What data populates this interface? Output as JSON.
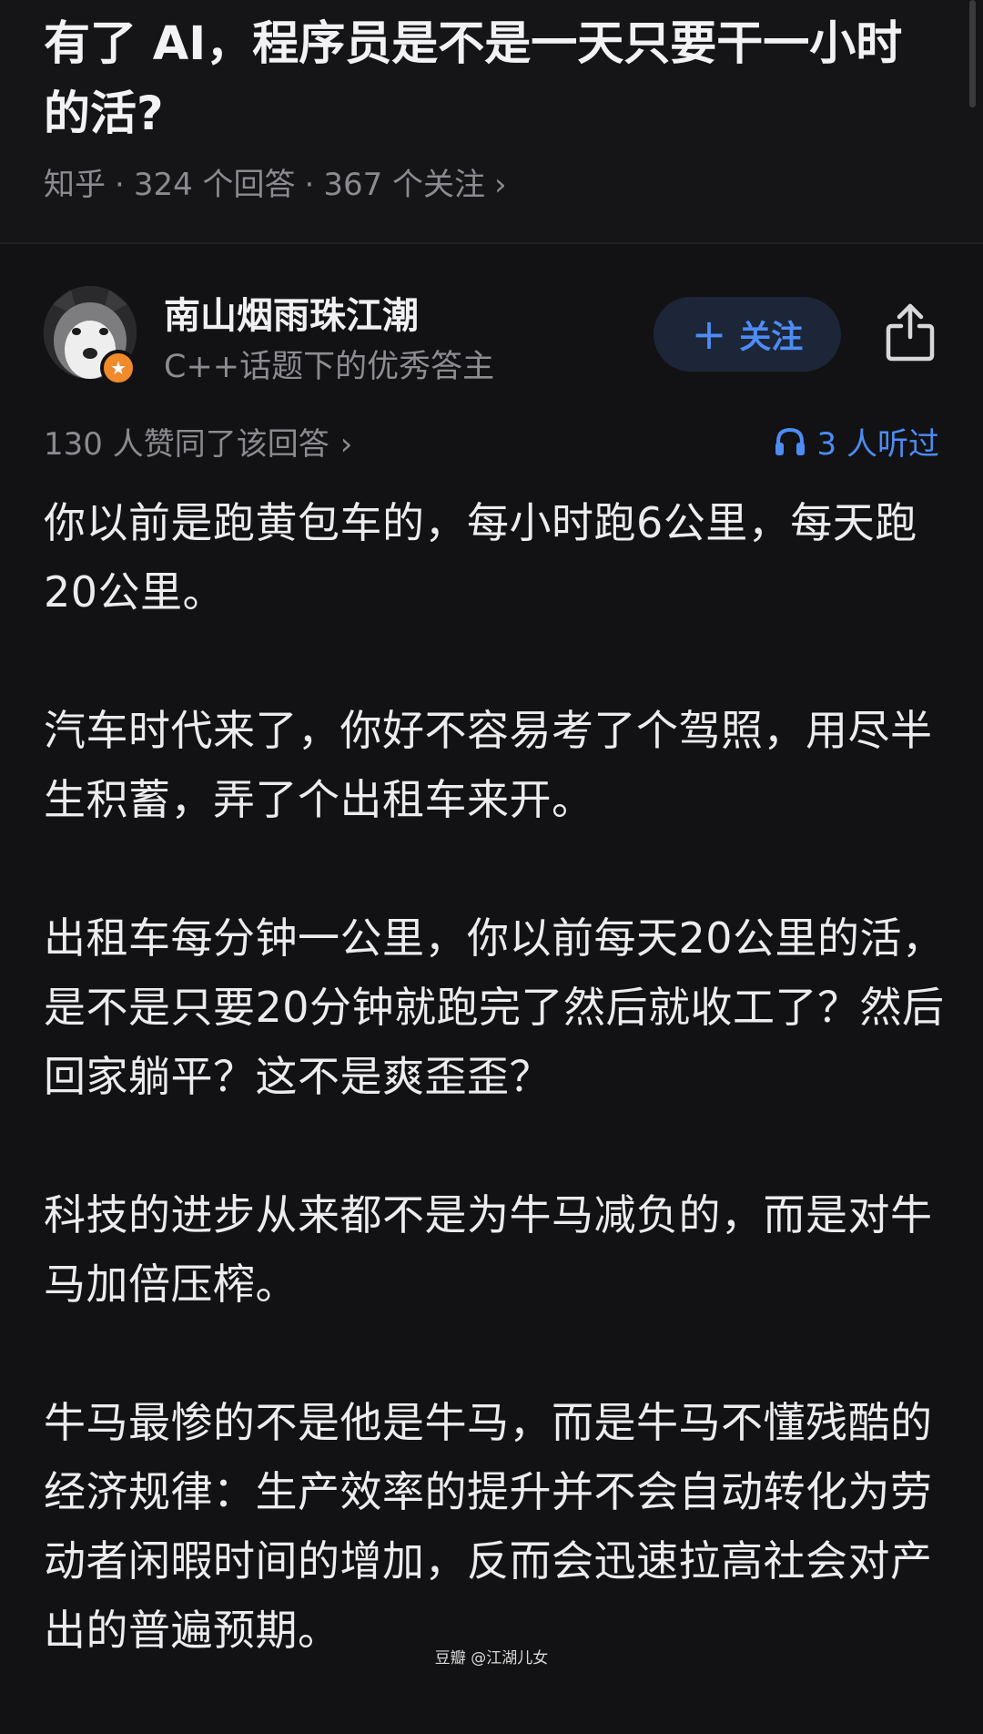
{
  "question": {
    "title": "有了 AI，程序员是不是一天只要干一小时的活?",
    "source": "知乎",
    "answers_count": "324 个回答",
    "followers_count": "367 个关注",
    "separator": "·",
    "chevron": "›"
  },
  "author": {
    "name": "南山烟雨珠江潮",
    "description": "C++话题下的优秀答主",
    "follow_label": "关注",
    "follow_plus": "+"
  },
  "stats": {
    "likes_text": "130 人赞同了该回答",
    "likes_chevron": "›",
    "listened_text": "3 人听过"
  },
  "answer": {
    "paragraphs": [
      "你以前是跑黄包车的，每小时跑6公里，每天跑20公里。",
      "汽车时代来了，你好不容易考了个驾照，用尽半生积蓄，弄了个出租车来开。",
      "出租车每分钟一公里，你以前每天20公里的活，是不是只要20分钟就跑完了然后就收工了？然后回家躺平？这不是爽歪歪？",
      "科技的进步从来都不是为牛马减负的，而是对牛马加倍压榨。",
      "牛马最惨的不是他是牛马，而是牛马不懂残酷的经济规律：生产效率的提升并不会自动转化为劳动者闲暇时间的增加，反而会迅速拉高社会对产出的普遍预期。"
    ]
  },
  "watermark": "豆瓣 @江湖儿女",
  "colors": {
    "background": "#121214",
    "accent": "#4d8cf5",
    "badge": "#f08a2a",
    "muted_text": "#8a8a90"
  },
  "icons": [
    "share-icon",
    "headphones-icon",
    "plus-icon",
    "chevron-right-icon",
    "star-badge-icon"
  ]
}
